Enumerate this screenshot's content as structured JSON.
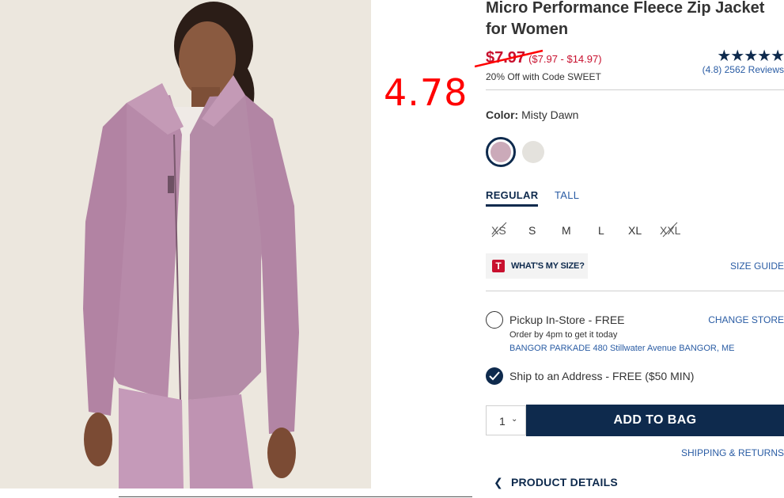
{
  "product": {
    "title": "Micro Performance Fleece Zip Jacket for Women",
    "price_now": "$7.97",
    "price_range": "($7.97 - $14.97)",
    "promo": "20% Off with Code SWEET",
    "rating_value": 4.8,
    "stars": "★★★★★",
    "reviews": "(4.8) 2562 Reviews"
  },
  "annotation": "4.78",
  "color": {
    "label": "Color:",
    "value": "Misty Dawn",
    "swatches": [
      "#cbaab9",
      "#e4e2dd"
    ]
  },
  "fit_tabs": [
    "REGULAR",
    "TALL"
  ],
  "sizes": [
    {
      "label": "XS",
      "available": false
    },
    {
      "label": "S",
      "available": true
    },
    {
      "label": "M",
      "available": true
    },
    {
      "label": "L",
      "available": true
    },
    {
      "label": "XL",
      "available": true
    },
    {
      "label": "XXL",
      "available": false
    }
  ],
  "size_help": {
    "icon_letter": "T",
    "whats_my_size": "WHAT'S MY SIZE?",
    "size_guide": "SIZE GUIDE"
  },
  "shipping": {
    "pickup_title": "Pickup In-Store - FREE",
    "pickup_sub": "Order by 4pm to get it today",
    "pickup_address": "BANGOR PARKADE 480 Stillwater Avenue  BANGOR, ME",
    "change_store": "CHANGE STORE",
    "ship_title": "Ship to an Address - FREE ($50 MIN)"
  },
  "purchase": {
    "quantity": "1",
    "add_to_bag": "ADD TO BAG",
    "shipping_returns": "SHIPPING & RETURNS"
  },
  "details_label": "PRODUCT DETAILS",
  "colors": {
    "navy": "#0e2a4d",
    "link_blue": "#2a5ca4",
    "sale_red": "#c8102e",
    "annotation_red": "#ff0000",
    "jacket": "#b68ba8"
  }
}
